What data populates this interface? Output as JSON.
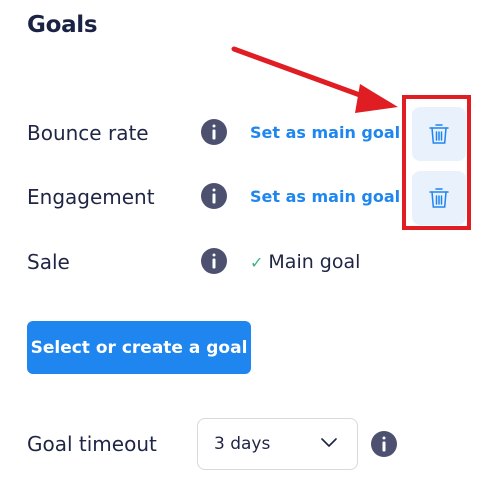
{
  "title": "Goals",
  "goals": [
    {
      "label": "Bounce rate",
      "action_label": "Set as main goal"
    },
    {
      "label": "Engagement",
      "action_label": "Set as main goal"
    },
    {
      "label": "Sale",
      "status_label": "Main goal"
    }
  ],
  "primary_button_label": "Select or create a goal",
  "timeout": {
    "label": "Goal timeout",
    "selected": "3 days"
  },
  "icons": {
    "info": "info-icon",
    "trash": "trash-icon",
    "check": "check-icon",
    "chevron": "chevron-down-icon"
  },
  "colors": {
    "accent": "#1f86f0",
    "heading": "#1b2345",
    "info_bg": "#4d516f",
    "trash_bg": "#e9f1fd",
    "highlight": "#e11d24",
    "check": "#3fb27f"
  }
}
